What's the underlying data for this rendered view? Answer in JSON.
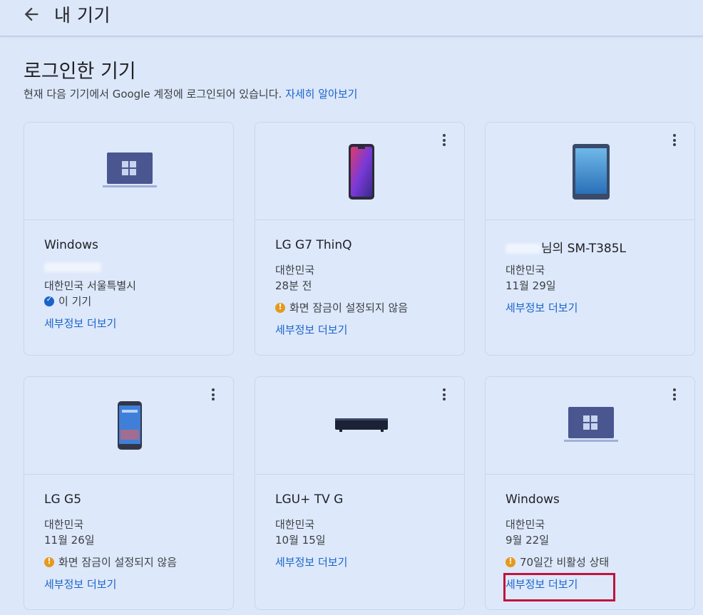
{
  "header": {
    "title": "내 기기",
    "back_icon": "arrow-back-icon"
  },
  "page": {
    "heading": "로그인한 기기",
    "subtitle": "현재 다음 기기에서 Google 계정에 로그인되어 있습니다.",
    "learn_more": "자세히 알아보기"
  },
  "cards": [
    {
      "name": "Windows",
      "location": "대한민국 서울특별시",
      "status": "이 기기",
      "details": "세부정보 더보기"
    },
    {
      "name": "LG G7 ThinQ",
      "location": "대한민국",
      "time": "28분 전",
      "status": "화면 잠금이 설정되지 않음",
      "details": "세부정보 더보기"
    },
    {
      "name": "님의 SM-T385L",
      "location": "대한민국",
      "time": "11월 29일",
      "details": "세부정보 더보기"
    },
    {
      "name": "LG G5",
      "location": "대한민국",
      "time": "11월 26일",
      "status": "화면 잠금이 설정되지 않음",
      "details": "세부정보 더보기"
    },
    {
      "name": "LGU+ TV G",
      "location": "대한민국",
      "time": "10월 15일",
      "details": "세부정보 더보기"
    },
    {
      "name": "Windows",
      "location": "대한민국",
      "time": "9월 22일",
      "status": "70일간 비활성 상태",
      "details": "세부정보 더보기"
    }
  ],
  "colors": {
    "background": "#dce7fa",
    "link": "#1a64c8",
    "warning": "#e59a1a",
    "highlight": "#c0143c"
  }
}
